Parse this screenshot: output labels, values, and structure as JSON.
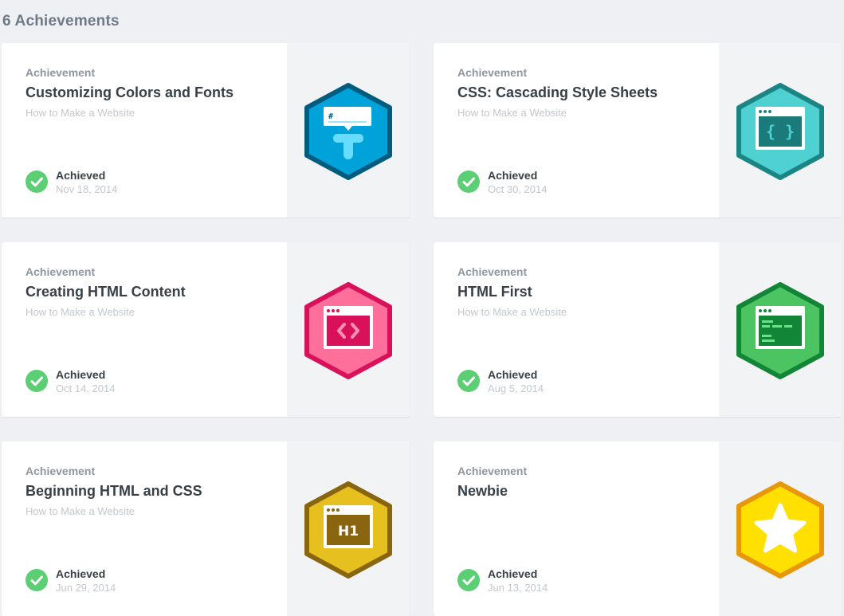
{
  "page": {
    "title": "6 Achievements"
  },
  "achievements": [
    {
      "label": "Achievement",
      "title": "Customizing Colors and Fonts",
      "course": "How to Make a Website",
      "status": "Achieved",
      "date": "Nov 18, 2014",
      "badge_icon": "typography-icon",
      "badge_color": "#00a3d9",
      "badge_border": "#005c7f"
    },
    {
      "label": "Achievement",
      "title": "CSS: Cascading Style Sheets",
      "course": "How to Make a Website",
      "status": "Achieved",
      "date": "Oct 30, 2014",
      "badge_icon": "curly-braces-icon",
      "badge_color": "#4fd1d1",
      "badge_border": "#1b8585"
    },
    {
      "label": "Achievement",
      "title": "Creating HTML Content",
      "course": "How to Make a Website",
      "status": "Achieved",
      "date": "Oct 14, 2014",
      "badge_icon": "code-brackets-icon",
      "badge_color": "#ff6f9b",
      "badge_border": "#d9105a"
    },
    {
      "label": "Achievement",
      "title": "HTML First",
      "course": "How to Make a Website",
      "status": "Achieved",
      "date": "Aug 5, 2014",
      "badge_icon": "code-lines-icon",
      "badge_color": "#4cc462",
      "badge_border": "#128537"
    },
    {
      "label": "Achievement",
      "title": "Beginning HTML and CSS",
      "course": "How to Make a Website",
      "status": "Achieved",
      "date": "Jun 29, 2014",
      "badge_icon": "h1-icon",
      "badge_color": "#e6c01e",
      "badge_border": "#8a6510",
      "badge_text": "H1"
    },
    {
      "label": "Achievement",
      "title": "Newbie",
      "course": "",
      "status": "Achieved",
      "date": "Jun 13, 2014",
      "badge_icon": "star-icon",
      "badge_color": "#ffe000",
      "badge_border": "#e8970a"
    }
  ]
}
